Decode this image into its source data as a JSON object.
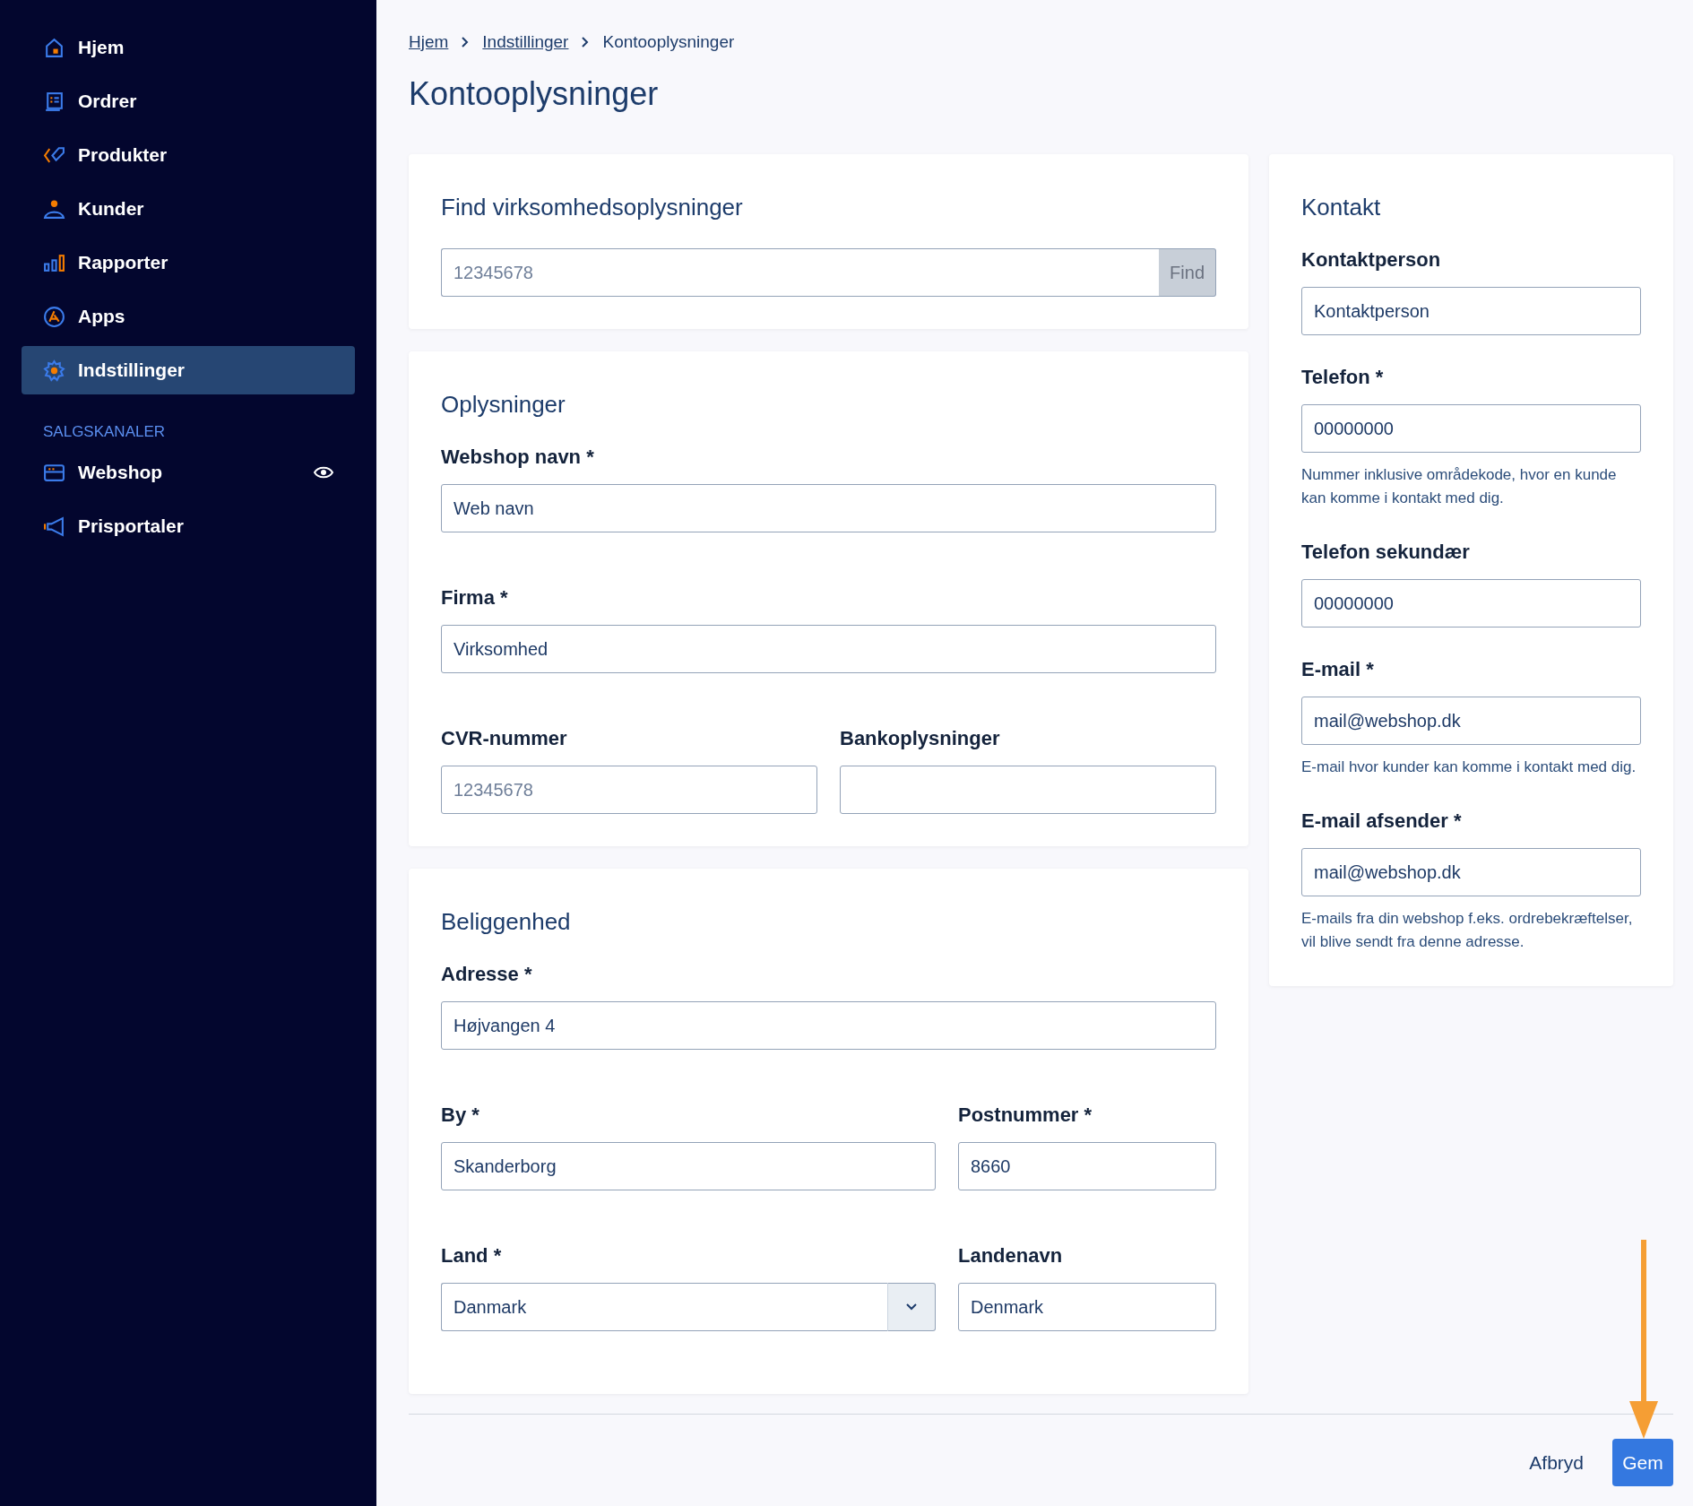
{
  "sidebar": {
    "items": [
      {
        "label": "Hjem",
        "selected": false
      },
      {
        "label": "Ordrer",
        "selected": false
      },
      {
        "label": "Produkter",
        "selected": false
      },
      {
        "label": "Kunder",
        "selected": false
      },
      {
        "label": "Rapporter",
        "selected": false
      },
      {
        "label": "Apps",
        "selected": false
      },
      {
        "label": "Indstillinger",
        "selected": true
      }
    ],
    "section": "SALGSKANALER",
    "channels": [
      {
        "label": "Webshop",
        "selected": false
      },
      {
        "label": "Prisportaler",
        "selected": false
      }
    ]
  },
  "breadcrumb": [
    {
      "label": "Hjem",
      "kind": "link"
    },
    {
      "label": "Indstillinger",
      "kind": "link"
    },
    {
      "label": "Kontooplysninger",
      "kind": "current"
    }
  ],
  "title": "Kontooplysninger",
  "cards": [
    {
      "title": "Find virksomhedsoplysninger",
      "rows": [
        [
          {
            "kind": "search",
            "placeholder": "12345678",
            "button": "Find"
          }
        ]
      ]
    },
    {
      "title": "Oplysninger",
      "rows": [
        [
          {
            "kind": "text",
            "label": "Webshop navn *",
            "value": "Web navn"
          }
        ],
        [
          {
            "kind": "text",
            "label": "Firma *",
            "value": "Virksomhed"
          }
        ],
        [
          {
            "kind": "text",
            "label": "CVR-nummer",
            "placeholder": "12345678"
          },
          {
            "kind": "text",
            "label": "Bankoplysninger"
          }
        ]
      ]
    },
    {
      "title": "Beliggenhed",
      "rows": [
        [
          {
            "kind": "text",
            "label": "Adresse *",
            "value": "Højvangen 4"
          }
        ],
        [
          {
            "kind": "text",
            "label": "By *",
            "value": "Skanderborg"
          },
          {
            "kind": "text",
            "label": "Postnummer *",
            "value": "8660"
          }
        ],
        [
          {
            "kind": "select",
            "label": "Land *",
            "value": "Danmark"
          },
          {
            "kind": "text",
            "label": "Landenavn",
            "value": "Denmark"
          }
        ]
      ]
    }
  ],
  "contact": {
    "title": "Kontakt",
    "fields": [
      {
        "label": "Kontaktperson",
        "value": "Kontaktperson"
      },
      {
        "label": "Telefon *",
        "value": "00000000",
        "help": "Nummer inklusive områdekode, hvor en kunde kan komme i kontakt med dig."
      },
      {
        "label": "Telefon sekundær",
        "value": "00000000"
      },
      {
        "label": "E-mail *",
        "value": "mail@webshop.dk",
        "help": "E-mail hvor kunder kan komme i kontakt med dig."
      },
      {
        "label": "E-mail afsender *",
        "value": "mail@webshop.dk",
        "help": "E-mails fra din webshop f.eks. ordrebekræftelser, vil blive sendt fra denne adresse."
      }
    ]
  },
  "actions": {
    "cancel": "Afbryd",
    "save": "Gem"
  }
}
